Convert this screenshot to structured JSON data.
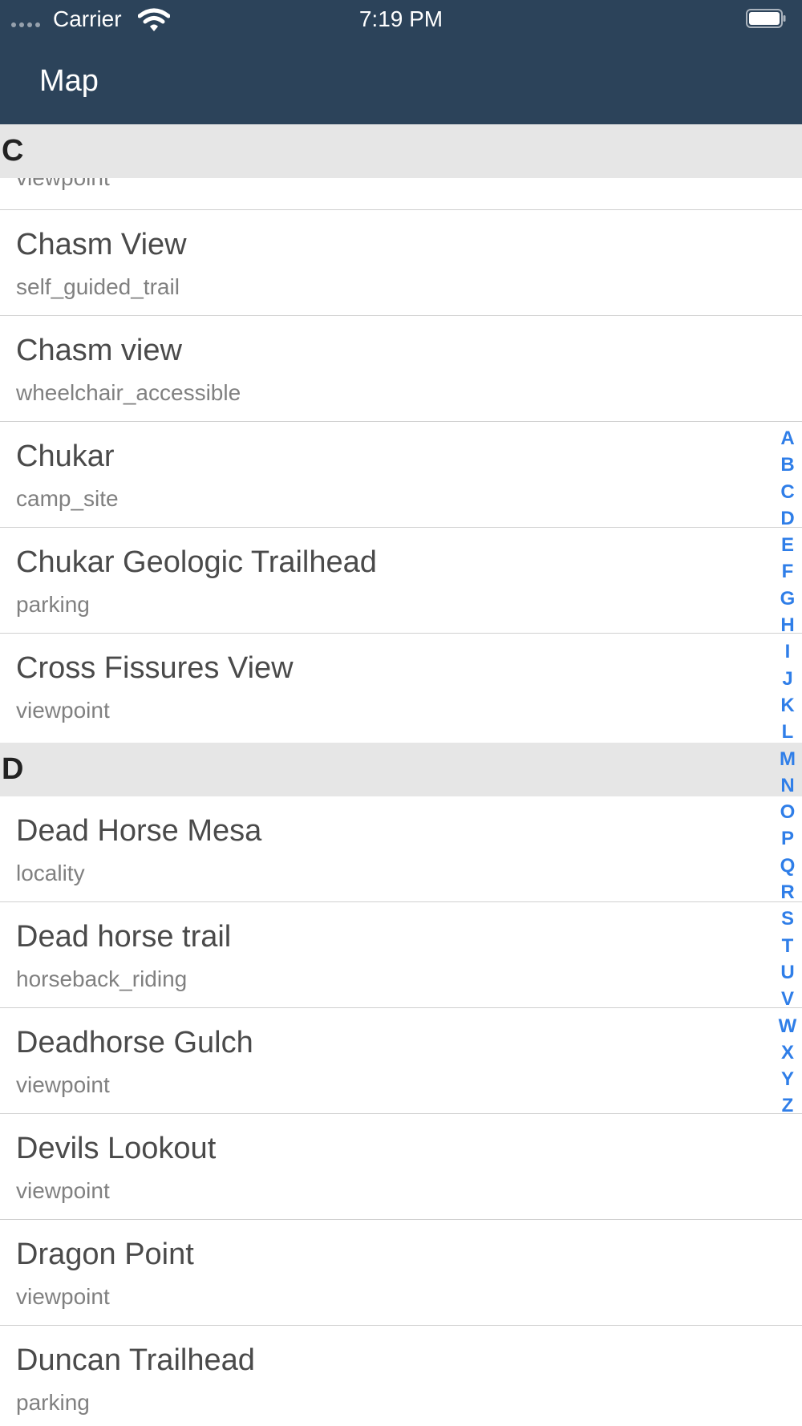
{
  "status_bar": {
    "carrier": "Carrier",
    "time": "7:19 PM"
  },
  "nav": {
    "title": "Map"
  },
  "list": {
    "partial_subtitle": "viewpoint",
    "sections": [
      {
        "header": "C",
        "rows": [
          {
            "title": "Chasm View",
            "subtitle": "self_guided_trail"
          },
          {
            "title": "Chasm view",
            "subtitle": "wheelchair_accessible"
          },
          {
            "title": "Chukar",
            "subtitle": "camp_site"
          },
          {
            "title": "Chukar Geologic Trailhead",
            "subtitle": "parking"
          },
          {
            "title": "Cross Fissures View",
            "subtitle": "viewpoint"
          }
        ]
      },
      {
        "header": "D",
        "rows": [
          {
            "title": "Dead Horse Mesa",
            "subtitle": "locality"
          },
          {
            "title": "Dead horse trail",
            "subtitle": "horseback_riding"
          },
          {
            "title": "Deadhorse Gulch",
            "subtitle": "viewpoint"
          },
          {
            "title": "Devils Lookout",
            "subtitle": "viewpoint"
          },
          {
            "title": "Dragon Point",
            "subtitle": "viewpoint"
          },
          {
            "title": "Duncan Trailhead",
            "subtitle": "parking"
          }
        ]
      }
    ]
  },
  "index_letters": [
    "A",
    "B",
    "C",
    "D",
    "E",
    "F",
    "G",
    "H",
    "I",
    "J",
    "K",
    "L",
    "M",
    "N",
    "O",
    "P",
    "Q",
    "R",
    "S",
    "T",
    "U",
    "V",
    "W",
    "X",
    "Y",
    "Z"
  ],
  "colors": {
    "nav_background": "#2c435a",
    "index_accent": "#2f7ee8",
    "section_header_bg": "#e6e6e6"
  }
}
